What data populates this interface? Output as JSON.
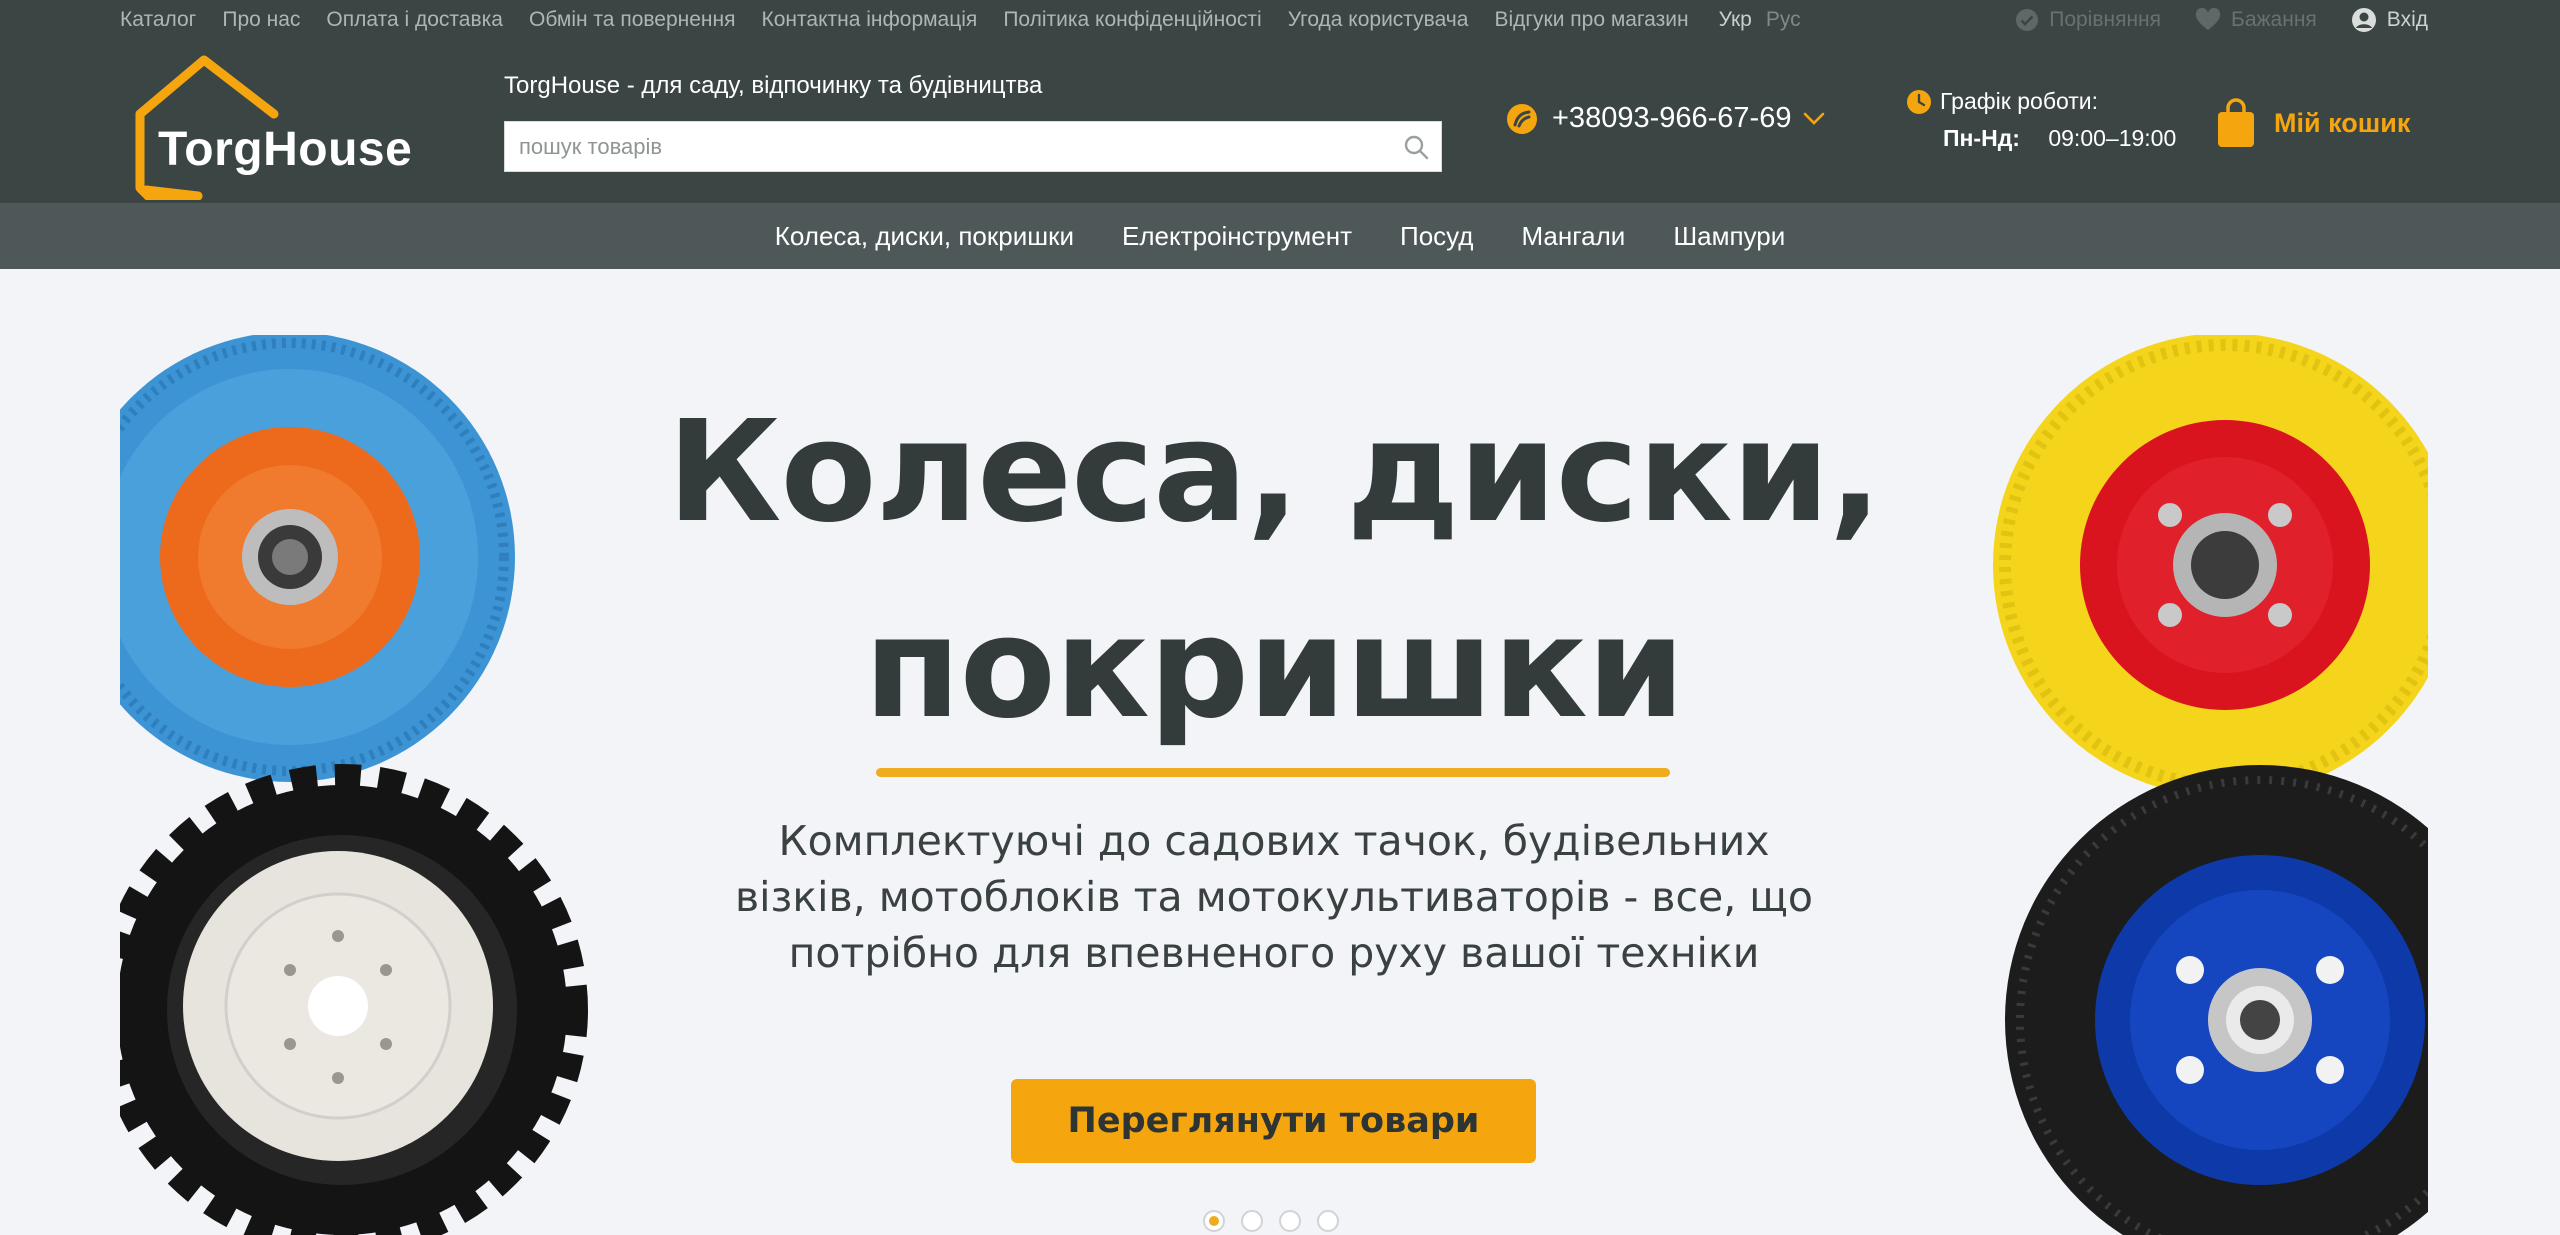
{
  "topbar": {
    "links": [
      "Каталог",
      "Про нас",
      "Оплата і доставка",
      "Обмін та повернення",
      "Контактна інформація",
      "Політика конфіденційності",
      "Угода користувача",
      "Відгуки про магазин"
    ],
    "lang_active": "Укр",
    "lang_other": "Рус",
    "compare_label": "Порівняння",
    "wishlist_label": "Бажання",
    "login_label": "Вхід"
  },
  "header": {
    "logo_text": "TorgHouse",
    "tagline": "TorgHouse - для саду, відпочинку та будівництва",
    "search_placeholder": "пошук товарів",
    "phone": "+38093-966-67-69",
    "hours_title": "Графік роботи:",
    "hours_days": "Пн-Нд:",
    "hours_time": "09:00–19:00",
    "cart_label": "Мій кошик"
  },
  "catnav": {
    "items": [
      "Колеса, диски, покришки",
      "Електроінструмент",
      "Посуд",
      "Мангали",
      "Шампури"
    ]
  },
  "hero": {
    "title_line1": "Колеса, диски,",
    "title_line2": "покришки",
    "description": "Комплектуючі до садових тачок, будівельних візків, мотоблоків та мотокультиваторів - все, що потрібно для впевненого руху вашої техніки",
    "button_label": "Переглянути товари",
    "slides_count": 4,
    "active_slide": 1
  },
  "colors": {
    "header_bg": "#3b4544",
    "nav_bg": "#4e5858",
    "accent": "#f5a60f",
    "hero_bg": "#f3f4f8"
  }
}
